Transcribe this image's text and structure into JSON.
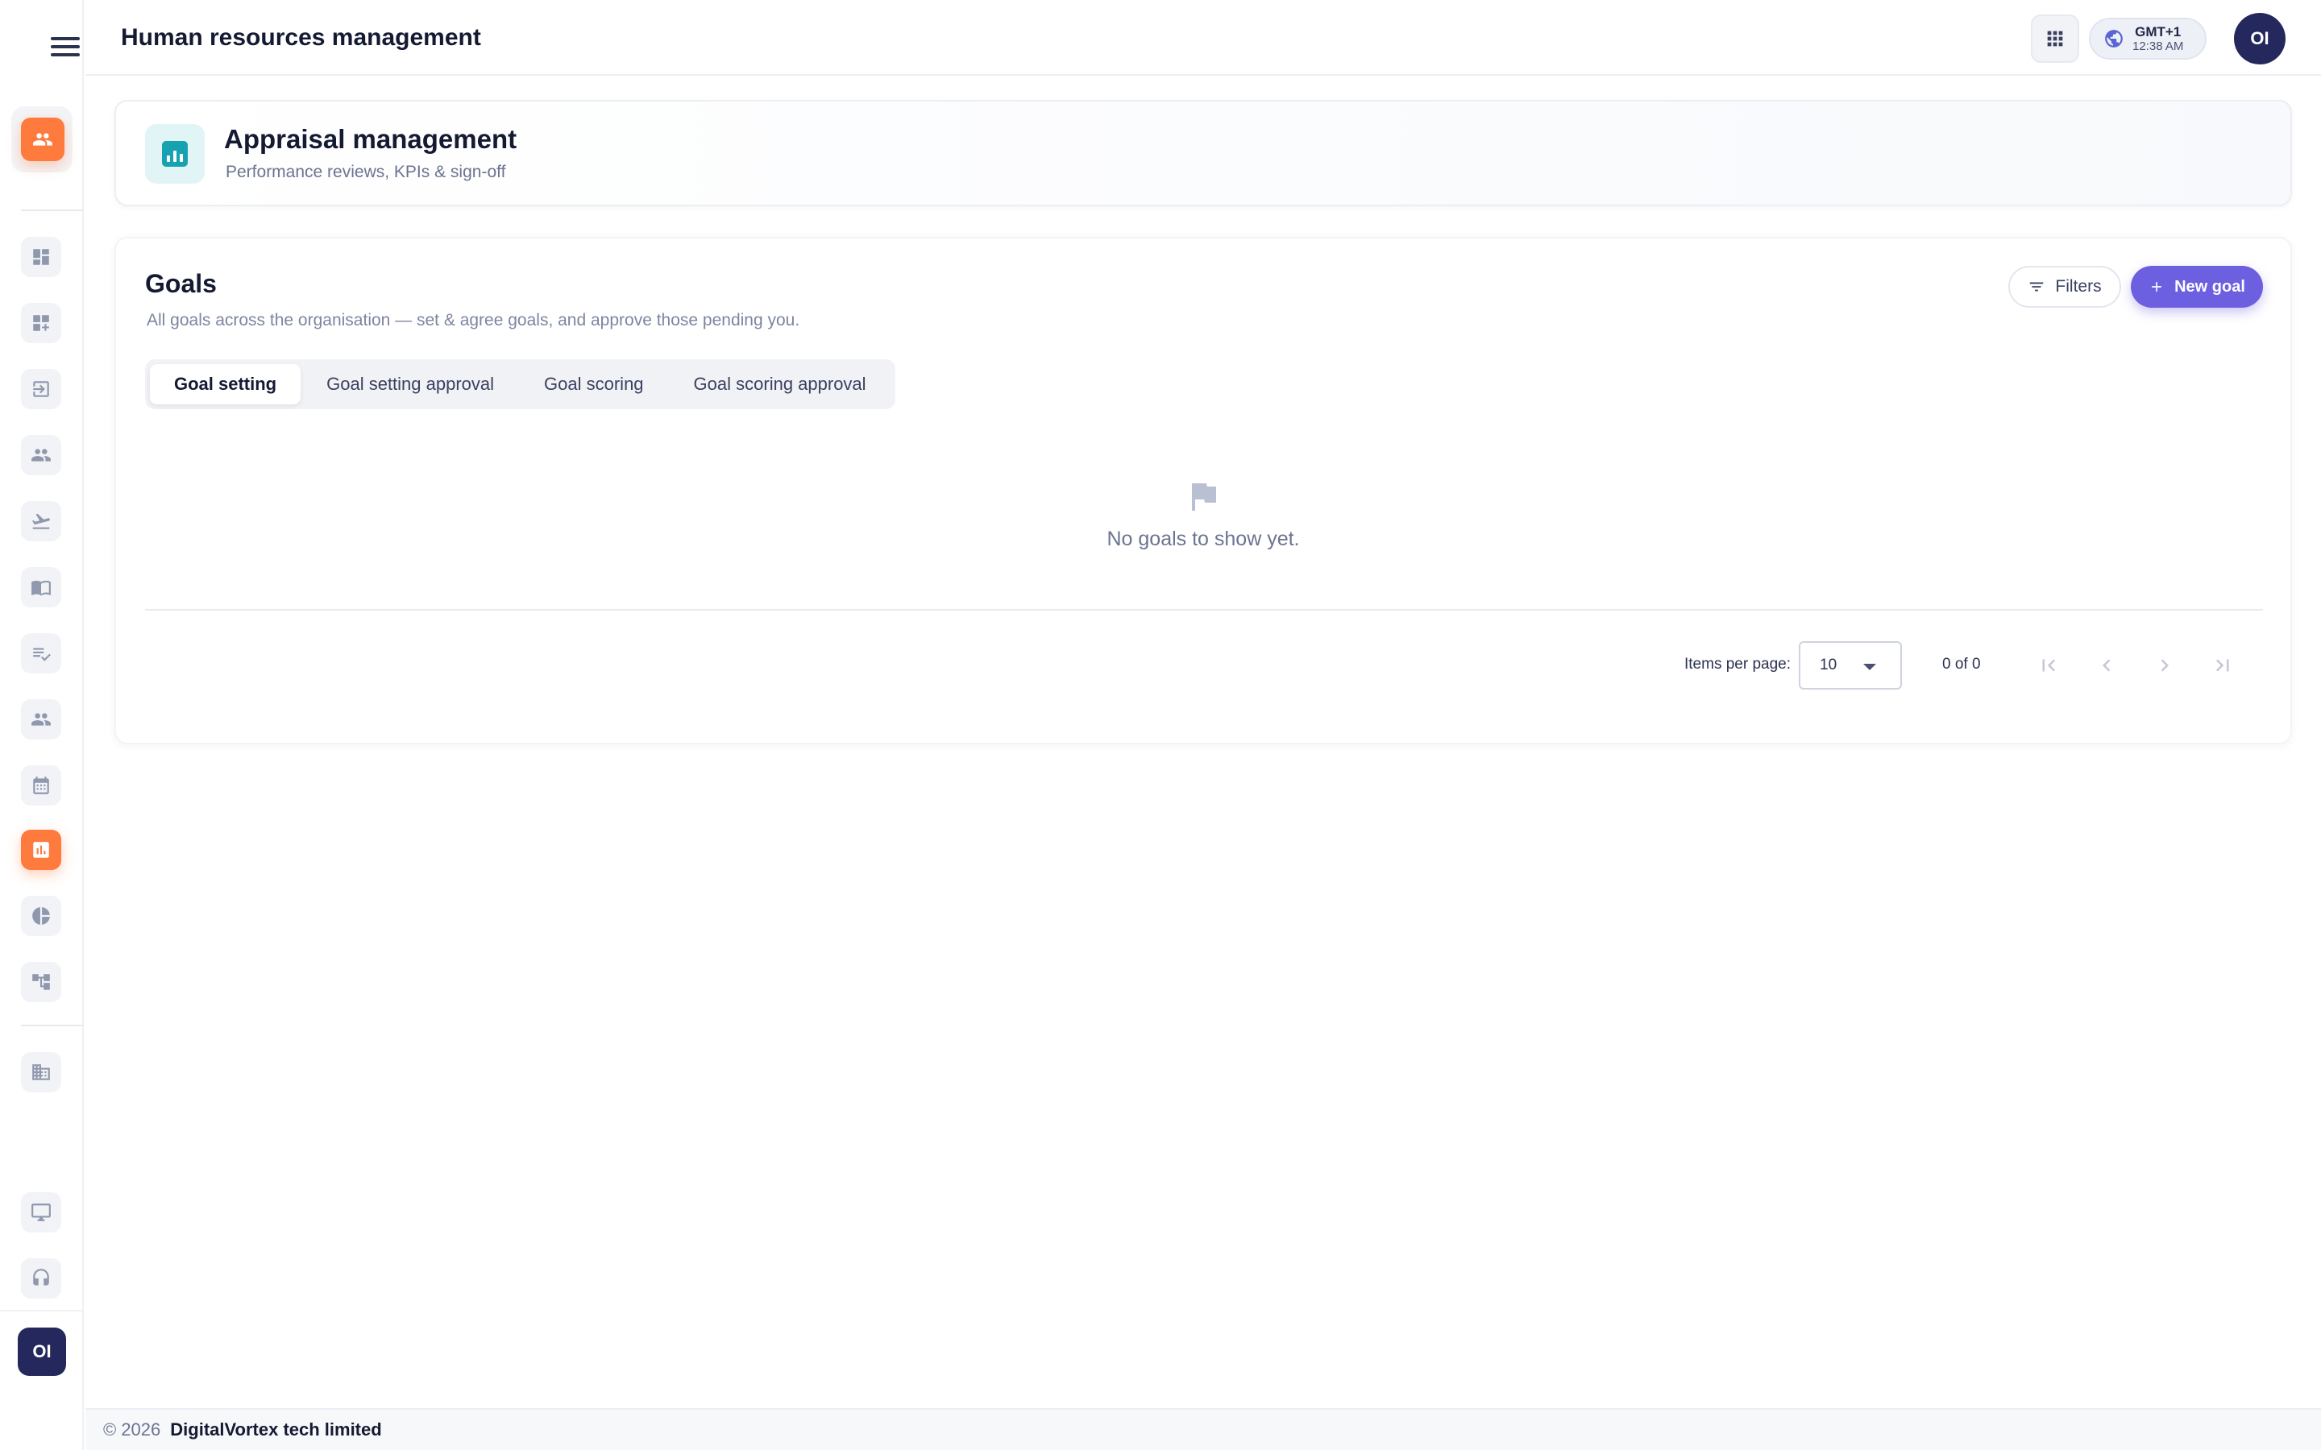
{
  "app": {
    "title": "Human resources management"
  },
  "topbar": {
    "timezone": {
      "zone": "GMT+1",
      "time": "12:38 AM"
    },
    "user_initials": "OI",
    "icons": {
      "apps": "apps-grid-icon",
      "globe": "globe-icon"
    }
  },
  "sidebar": {
    "home_icon": "people-icon",
    "items": [
      {
        "icon": "dashboard-icon"
      },
      {
        "icon": "dashboard-add-icon"
      },
      {
        "icon": "login-icon"
      },
      {
        "icon": "people-icon"
      },
      {
        "icon": "flight-icon"
      },
      {
        "icon": "book-icon"
      },
      {
        "icon": "checklist-icon"
      },
      {
        "icon": "people-icon"
      },
      {
        "icon": "calendar-icon"
      },
      {
        "icon": "bar-chart-icon",
        "active": true
      },
      {
        "icon": "pie-chart-icon"
      },
      {
        "icon": "org-chart-icon"
      },
      {
        "icon": "building-icon"
      },
      {
        "icon": "monitor-icon"
      },
      {
        "icon": "support-icon"
      }
    ],
    "user_initials": "OI"
  },
  "hero": {
    "title": "Appraisal management",
    "subtitle": "Performance reviews, KPIs & sign-off",
    "icon": "bar-chart-icon",
    "icon_color": "#17a2b1"
  },
  "goals": {
    "title": "Goals",
    "subtitle": "All goals across the organisation — set & agree goals, and approve those pending you.",
    "filters_label": "Filters",
    "new_goal_label": "New goal",
    "tabs": [
      {
        "label": "Goal setting",
        "active": true
      },
      {
        "label": "Goal setting approval"
      },
      {
        "label": "Goal scoring"
      },
      {
        "label": "Goal scoring approval"
      }
    ],
    "empty_text": "No goals to show yet.",
    "empty_icon": "flag-icon"
  },
  "pagination": {
    "items_per_page_label": "Items per page:",
    "items_per_page_value": "10",
    "range_text": "0 of 0"
  },
  "footer": {
    "copyright": "© 2026",
    "company": "DigitalVortex tech limited"
  },
  "colors": {
    "accent_orange": "#ff7a3d",
    "primary_purple": "#6c5fe0",
    "navy": "#25285c"
  }
}
